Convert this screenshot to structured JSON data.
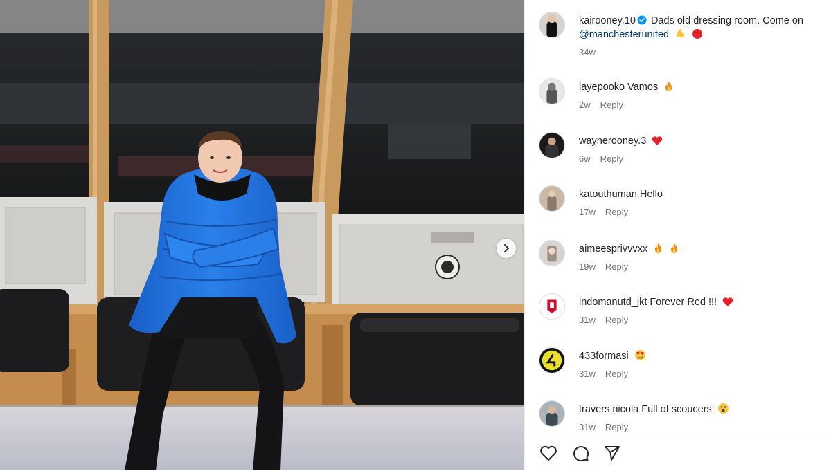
{
  "post": {
    "author": "kairooney.10",
    "caption": "Dads old dressing room. Come on",
    "mention": "@manchesterunited",
    "caption_emoji": [
      "flexed-biceps-emoji",
      "red-circle-emoji"
    ],
    "age": "34w"
  },
  "reply_label": "Reply",
  "comments": [
    {
      "user": "layepooko",
      "text": "Vamos",
      "emoji": [
        "fire-emoji"
      ],
      "age": "2w"
    },
    {
      "user": "waynerooney.3",
      "text": "",
      "emoji": [
        "red-heart-emoji"
      ],
      "age": "6w"
    },
    {
      "user": "katouthuman",
      "text": "Hello",
      "emoji": [],
      "age": "17w"
    },
    {
      "user": "aimeesprivvvxx",
      "text": "",
      "emoji": [
        "fire-emoji",
        "fire-emoji"
      ],
      "age": "19w"
    },
    {
      "user": "indomanutd_jkt",
      "text": "Forever Red !!!",
      "emoji": [
        "red-heart-emoji"
      ],
      "age": "31w"
    },
    {
      "user": "433formasi",
      "text": "",
      "emoji": [
        "heart-eyes-emoji"
      ],
      "age": "31w"
    },
    {
      "user": "travers.nicola",
      "text": "Full of scoucers",
      "emoji": [
        "astonished-face-emoji"
      ],
      "age": "31w"
    }
  ],
  "icons": {
    "like": "heart-outline-icon",
    "comment": "comment-bubble-icon",
    "share": "paper-plane-icon",
    "carousel_next": "chevron-right-icon"
  },
  "colors": {
    "verified": "#0095f6",
    "mention": "#00376b",
    "meta": "#737373",
    "jacket": "#1f6fd6"
  }
}
